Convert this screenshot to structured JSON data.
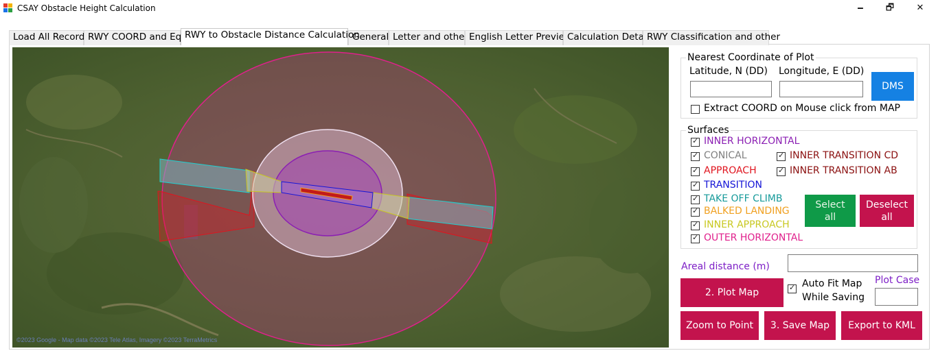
{
  "window": {
    "title": "CSAY Obstacle Height Calculation",
    "minimize_glyph": "🗕",
    "restore_glyph": "🗗",
    "close_glyph": "✕"
  },
  "tabs": [
    {
      "label": "Load All Record"
    },
    {
      "label": "RWY COORD and Eq"
    },
    {
      "label": "RWY to Obstacle Distance Calculation",
      "active": true
    },
    {
      "label": "General"
    },
    {
      "label": "Letter and others"
    },
    {
      "label": "English Letter Preview"
    },
    {
      "label": "Calculation Detail"
    },
    {
      "label": "RWY Classification and other"
    }
  ],
  "map": {
    "credit": "©2023 Google - Map data ©2023 Tele Atlas, Imagery ©2023 TerraMetrics"
  },
  "nearest": {
    "group_title": "Nearest Coordinate of Plot",
    "lat_label": "Latitude, N (DD)",
    "lon_label": "Longitude, E (DD)",
    "lat_value": "",
    "lon_value": "",
    "dms_button": "DMS",
    "extract_label": "Extract COORD on Mouse click from MAP",
    "extract_checked": false
  },
  "surfaces": {
    "group_title": "Surfaces",
    "items": [
      {
        "label": "INNER HORIZONTAL",
        "checked": true,
        "color": "#8b1fb3"
      },
      {
        "label": "CONICAL",
        "checked": true,
        "color": "#7f7f7f"
      },
      {
        "label": "INNER TRANSITION CD",
        "checked": true,
        "color": "#8b1010"
      },
      {
        "label": "APPROACH",
        "checked": true,
        "color": "#e0141e"
      },
      {
        "label": "INNER TRANSITION AB",
        "checked": true,
        "color": "#8b1010"
      },
      {
        "label": "TRANSITION",
        "checked": true,
        "color": "#1515d6"
      },
      {
        "label": "TAKE OFF CLIMB",
        "checked": true,
        "color": "#169a9a"
      },
      {
        "label": "BALKED LANDING",
        "checked": true,
        "color": "#f0a020"
      },
      {
        "label": "INNER APPROACH",
        "checked": true,
        "color": "#c8c820"
      },
      {
        "label": "OUTER HORIZONTAL",
        "checked": true,
        "color": "#e0208c"
      }
    ],
    "select_all": "Select all",
    "deselect_all": "Deselect all"
  },
  "areal": {
    "label": "Areal distance (m)",
    "value": ""
  },
  "plot": {
    "plot_map_button": "2. Plot Map",
    "auto_fit_label": "Auto Fit Map While Saving",
    "auto_fit_checked": true,
    "plot_case_label": "Plot Case",
    "plot_case_value": ""
  },
  "actions": {
    "zoom_button": "Zoom to Point",
    "save_button": "3. Save Map",
    "export_button": "Export to KML"
  },
  "colors": {
    "crimson": "#c3134d",
    "blue": "#1581e3",
    "green": "#0f9a48",
    "purple": "#7d1ec6"
  }
}
